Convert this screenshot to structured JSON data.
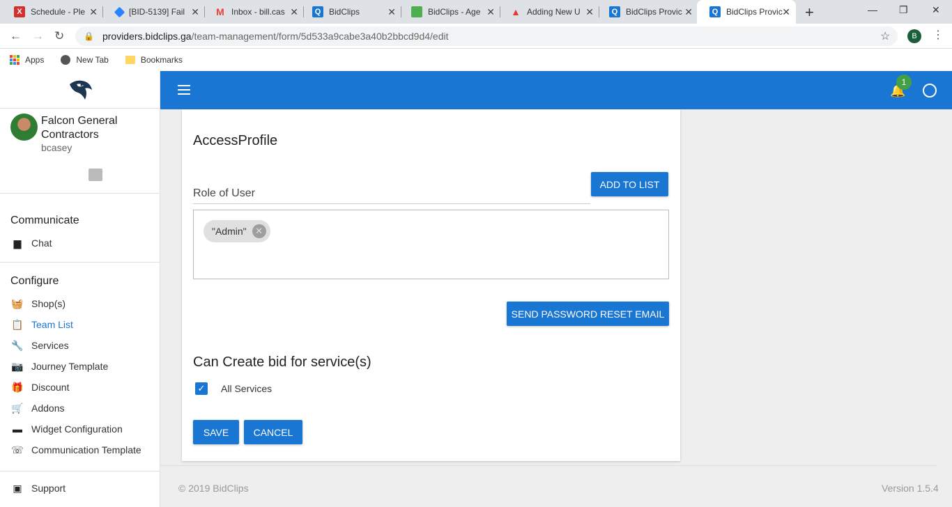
{
  "browser": {
    "tabs": [
      {
        "title": "Schedule - Ple",
        "icon": "x-logo-icon",
        "color": "#d32f2f"
      },
      {
        "title": "[BID-5139] Fail",
        "icon": "jira-icon",
        "color": "#2684ff"
      },
      {
        "title": "Inbox - bill.cas",
        "icon": "gmail-icon",
        "color": "#ea4335"
      },
      {
        "title": "BidClips",
        "icon": "bidclips-icon",
        "color": "#1976d2"
      },
      {
        "title": "BidClips - Age",
        "icon": "bidclips-agent-icon",
        "color": "#4caf50"
      },
      {
        "title": "Adding New U",
        "icon": "adding-new-user-icon",
        "color": "#e53935"
      },
      {
        "title": "BidClips Provic",
        "icon": "bidclips-icon",
        "color": "#1976d2"
      },
      {
        "title": "BidClips Provic",
        "icon": "bidclips-icon",
        "color": "#1976d2"
      }
    ],
    "url_host": "providers.bidclips.ga",
    "url_path": "/team-management/form/5d533a9cabe3a40b2bbcd9d4/edit",
    "profile_initial": "B",
    "bookmarks": [
      "Apps",
      "New Tab",
      "Bookmarks"
    ]
  },
  "sidebar": {
    "company": "Falcon General Contractors",
    "username": "bcasey",
    "communicate_title": "Communicate",
    "communicate_items": [
      {
        "label": "Chat",
        "icon": "chat-icon"
      }
    ],
    "configure_title": "Configure",
    "configure_items": [
      {
        "label": "Shop(s)",
        "icon": "basket-icon"
      },
      {
        "label": "Team List",
        "icon": "clipboard-icon"
      },
      {
        "label": "Services",
        "icon": "wrench-icon"
      },
      {
        "label": "Journey Template",
        "icon": "camera-icon"
      },
      {
        "label": "Discount",
        "icon": "gift-card-icon"
      },
      {
        "label": "Addons",
        "icon": "cart-add-icon"
      },
      {
        "label": "Widget Configuration",
        "icon": "widget-icon"
      },
      {
        "label": "Communication Template",
        "icon": "phone-icon"
      }
    ],
    "support_label": "Support"
  },
  "header": {
    "notification_count": "1"
  },
  "form": {
    "access_title": "AccessProfile",
    "role_label": "Role of User",
    "add_button": "ADD TO LIST",
    "chip": "\"Admin\"",
    "reset_button": "SEND PASSWORD RESET EMAIL",
    "can_create_title": "Can Create bid for service(s)",
    "all_services_label": "All Services",
    "all_services_checked": true,
    "save_button": "SAVE",
    "cancel_button": "CANCEL"
  },
  "footer": {
    "copyright": "© 2019 BidClips",
    "version": "Version 1.5.4"
  },
  "colors": {
    "primary": "#1976d2",
    "badge": "#43a047"
  }
}
